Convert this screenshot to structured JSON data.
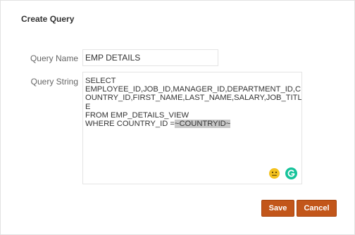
{
  "dialog": {
    "title": "Create Query"
  },
  "form": {
    "query_name_label": "Query Name",
    "query_name_value": "EMP DETAILS",
    "query_string_label": "Query String",
    "query_string_lines": [
      "SELECT",
      "EMPLOYEE_ID,JOB_ID,MANAGER_ID,DEPARTMENT_ID,C",
      "OUNTRY_ID,FIRST_NAME,LAST_NAME,SALARY,JOB_TITL",
      "E",
      "FROM EMP_DETAILS_VIEW"
    ],
    "query_string_last_line_prefix": "WHERE COUNTRY_ID =",
    "query_string_highlight": "~COUNTRYID~"
  },
  "icons": {
    "emoji": "neutral-face-icon",
    "grammarly": "grammarly-icon"
  },
  "buttons": {
    "save_label": "Save",
    "cancel_label": "Cancel"
  },
  "colors": {
    "button_bg": "#c2561a",
    "highlight_bg": "#c8c8c8",
    "grammarly_green": "#15c39a",
    "emoji_yellow": "#f4c21e"
  }
}
